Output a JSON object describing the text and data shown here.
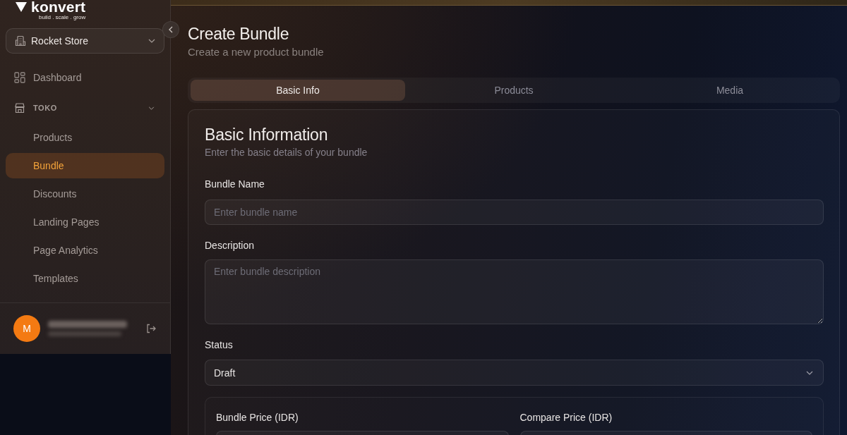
{
  "sidebar": {
    "logo": {
      "name": "konvert",
      "tagline": "build . scale . grow"
    },
    "store_selector": {
      "value": "Rocket Store"
    },
    "nav": [
      {
        "kind": "link",
        "label": "Dashboard",
        "selected": false
      },
      {
        "kind": "section",
        "label": "TOKO",
        "expanded": true,
        "children": [
          {
            "label": "Products",
            "selected": false
          },
          {
            "label": "Bundle",
            "selected": true
          },
          {
            "label": "Discounts",
            "selected": false
          },
          {
            "label": "Landing Pages",
            "selected": false
          },
          {
            "label": "Page Analytics",
            "selected": false
          },
          {
            "label": "Templates",
            "selected": false
          }
        ]
      }
    ],
    "user": {
      "initial": "M"
    }
  },
  "main": {
    "title": "Create Bundle",
    "subtitle": "Create a new product bundle",
    "tabs": [
      {
        "label": "Basic Info",
        "selected": true
      },
      {
        "label": "Products",
        "selected": false
      },
      {
        "label": "Media",
        "selected": false
      }
    ],
    "card": {
      "title": "Basic Information",
      "subtitle": "Enter the basic details of your bundle",
      "fields": [
        {
          "kind": "text",
          "label": "Bundle Name",
          "placeholder": "Enter bundle name"
        },
        {
          "kind": "textarea",
          "label": "Description",
          "placeholder": "Enter bundle description"
        },
        {
          "kind": "select",
          "label": "Status",
          "value": "Draft"
        }
      ],
      "pricing": {
        "fields": [
          {
            "label": "Bundle Price (IDR)"
          },
          {
            "label": "Compare Price (IDR)"
          }
        ]
      }
    }
  }
}
